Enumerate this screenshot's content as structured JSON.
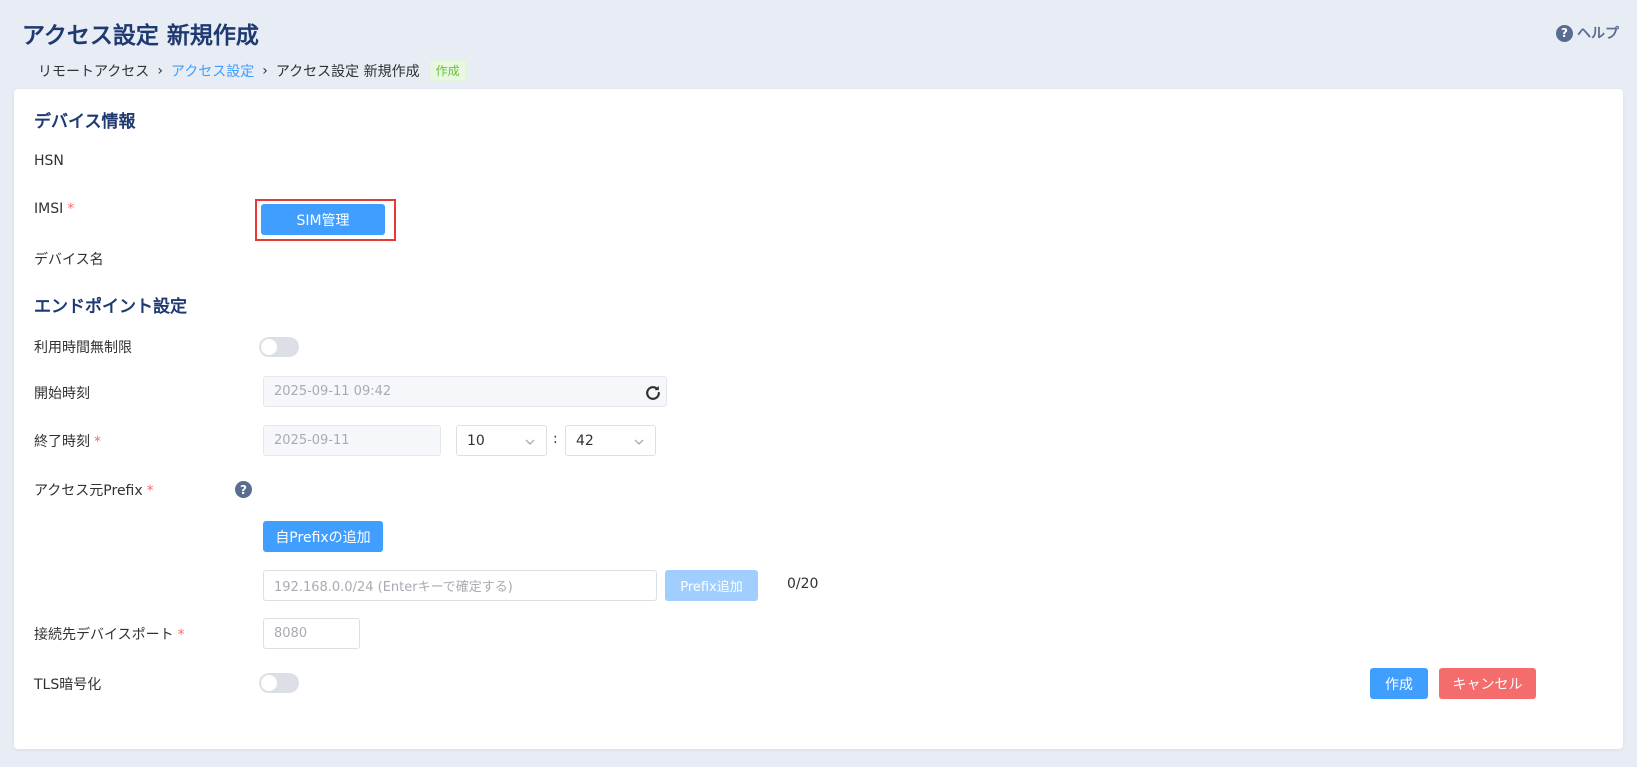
{
  "header": {
    "title": "アクセス設定 新規作成",
    "help_label": "ヘルプ",
    "help_icon": "?"
  },
  "breadcrumb": {
    "items": [
      "リモートアクセス",
      "アクセス設定",
      "アクセス設定 新規作成"
    ],
    "tag": "作成"
  },
  "device_info": {
    "section_title": "デバイス情報",
    "hsn_label": "HSN",
    "imsi_label": "IMSI",
    "sim_button": "SIM管理",
    "device_name_label": "デバイス名"
  },
  "endpoint": {
    "section_title": "エンドポイント設定",
    "unlimited_label": "利用時間無制限",
    "unlimited_on": false,
    "start_label": "開始時刻",
    "start_value": "2025-09-11 09:42",
    "end_label": "終了時刻",
    "end_date": "2025-09-11",
    "end_hour": "10",
    "end_minute": "42",
    "time_separator": ":",
    "prefix_label": "アクセス元Prefix",
    "prefix_help_icon": "?",
    "add_own_prefix_button": "自Prefixの追加",
    "prefix_placeholder": "192.168.0.0/24 (Enterキーで確定する)",
    "prefix_add_button": "Prefix追加",
    "prefix_count": "0/20",
    "port_label": "接続先デバイスポート",
    "port_placeholder": "8080",
    "tls_label": "TLS暗号化",
    "tls_on": false,
    "required_mark": "*"
  },
  "actions": {
    "create": "作成",
    "cancel": "キャンセル"
  },
  "colors": {
    "primary": "#409eff",
    "danger": "#f56c6c",
    "title": "#1f3a70",
    "highlight": "#e53935"
  }
}
